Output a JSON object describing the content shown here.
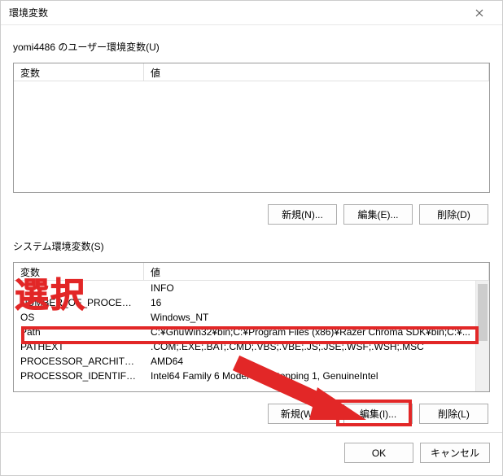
{
  "window": {
    "title": "環境変数"
  },
  "user_section": {
    "label": "yomi4486 のユーザー環境変数(U)",
    "columns": {
      "var": "変数",
      "val": "値"
    },
    "rows": []
  },
  "system_section": {
    "label": "システム環境変数(S)",
    "columns": {
      "var": "変数",
      "val": "値"
    },
    "rows": [
      {
        "var": "",
        "val": "INFO"
      },
      {
        "var": "NUMBER_OF_PROCESSORS",
        "val": "16"
      },
      {
        "var": "OS",
        "val": "Windows_NT"
      },
      {
        "var": "Path",
        "val": "C:¥GnuWin32¥bin;C:¥Program Files (x86)¥Razer Chroma SDK¥bin;C:¥..."
      },
      {
        "var": "PATHEXT",
        "val": ".COM;.EXE;.BAT;.CMD;.VBS;.VBE;.JS;.JSE;.WSF;.WSH;.MSC"
      },
      {
        "var": "PROCESSOR_ARCHITECTURE",
        "val": "AMD64"
      },
      {
        "var": "PROCESSOR_IDENTIFIER",
        "val": "Intel64 Family 6 Model 154 Stepping 1, GenuineIntel"
      }
    ]
  },
  "buttons": {
    "user_new": "新規(N)...",
    "user_edit": "編集(E)...",
    "user_delete": "削除(D)",
    "sys_new": "新規(W)...",
    "sys_edit": "編集(I)...",
    "sys_delete": "削除(L)",
    "ok": "OK",
    "cancel": "キャンセル"
  },
  "annotation": {
    "label": "選択"
  }
}
